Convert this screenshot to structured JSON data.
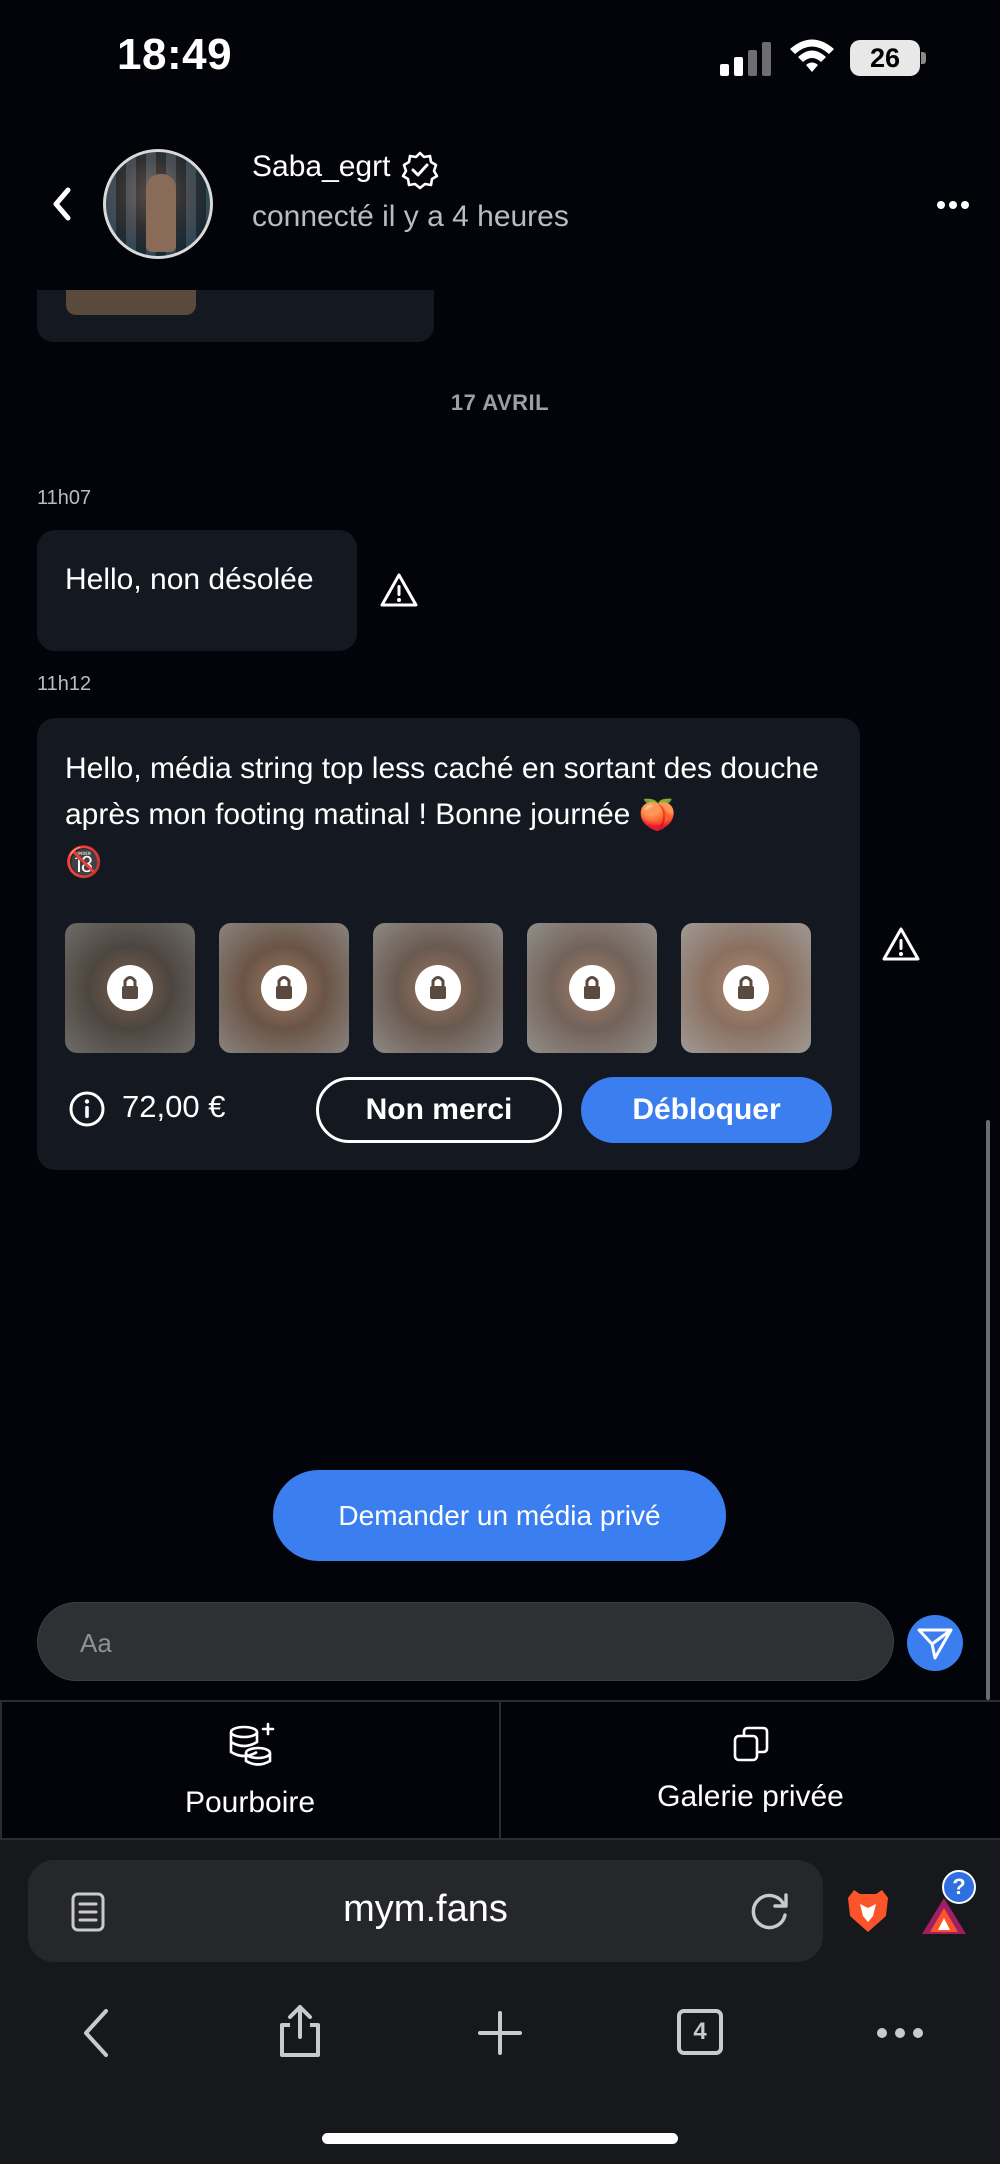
{
  "status_bar": {
    "time": "18:49",
    "battery": "26"
  },
  "header": {
    "username": "Saba_egrt",
    "presence": "connecté il y a 4 heures"
  },
  "chat": {
    "date_separator": "17 AVRIL",
    "messages": [
      {
        "time": "11h07",
        "text": "Hello, non désolée"
      },
      {
        "time": "11h12",
        "text": "Hello, média string top less caché en sortant des douche après mon footing matinal ! Bonne journée",
        "emoji_peach": "🍑",
        "emoji_18": "🔞",
        "price": "72,00 €",
        "decline_label": "Non merci",
        "unlock_label": "Débloquer",
        "locked_media_count": 5
      }
    ],
    "request_button": "Demander un média privé",
    "composer_placeholder": "Aa"
  },
  "tabs": [
    {
      "label": "Pourboire",
      "icon": "coins-plus-icon"
    },
    {
      "label": "Galerie privée",
      "icon": "gallery-icon"
    }
  ],
  "browser": {
    "url": "mym.fans",
    "tab_count": "4",
    "brave_badge": "?"
  },
  "colors": {
    "accent": "#3b7ef0",
    "bubble": "#141820",
    "background": "#03040a"
  }
}
